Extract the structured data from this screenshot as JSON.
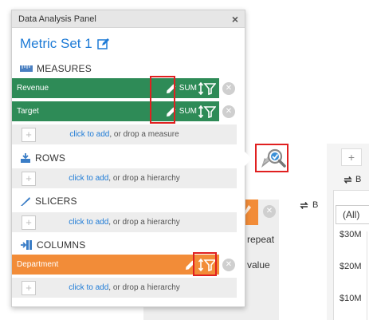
{
  "panel": {
    "title": "Data Analysis Panel",
    "close_glyph": "×",
    "metric_set_title": "Metric Set 1"
  },
  "sections": {
    "measures": {
      "label": "MEASURES"
    },
    "rows": {
      "label": "ROWS"
    },
    "slicers": {
      "label": "SLICERS"
    },
    "columns": {
      "label": "COLUMNS"
    }
  },
  "measures": [
    {
      "name": "Revenue",
      "aggregation": "SUM"
    },
    {
      "name": "Target",
      "aggregation": "SUM"
    }
  ],
  "columns": [
    {
      "name": "Department"
    }
  ],
  "drop_zones": {
    "measures": {
      "link": "click to add",
      "rest": ", or drop a measure"
    },
    "rows": {
      "link": "click to add",
      "rest": ", or drop a hierarchy"
    },
    "slicers": {
      "link": "click to add",
      "rest": ", or drop a hierarchy"
    },
    "columns": {
      "link": "click to add",
      "rest": ", or drop a hierarchy"
    }
  },
  "background": {
    "text_repeat": "o repeat",
    "text_value": "n value",
    "b_label_1": "B",
    "b_label_2": "B",
    "all_select": "(All)",
    "ticks": [
      "$30M",
      "$20M",
      "$10M"
    ],
    "plus_glyph": "+"
  },
  "icons": {
    "close": "close-icon",
    "edit": "edit-icon",
    "measures": "ruler-icon",
    "rows": "rows-icon",
    "slicers": "slicer-icon",
    "columns": "columns-icon",
    "pencil": "pencil-icon",
    "sort_filter": "sort-filter-icon",
    "remove": "remove-icon",
    "search_analysis": "search-analysis-icon",
    "swap": "swap-icon"
  },
  "colors": {
    "measure_pill": "#2e8b57",
    "column_pill": "#f28c38",
    "link": "#1e7bd6",
    "highlight": "#e02020"
  }
}
